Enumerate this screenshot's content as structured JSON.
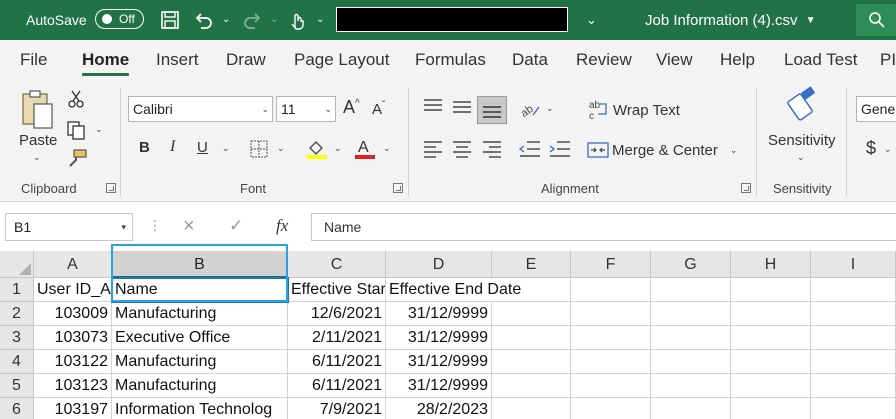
{
  "titlebar": {
    "autosave_label": "AutoSave",
    "autosave_state": "Off",
    "filename": "Job Information (4).csv"
  },
  "ribbon_tabs": [
    "File",
    "Home",
    "Insert",
    "Draw",
    "Page Layout",
    "Formulas",
    "Data",
    "Review",
    "View",
    "Help",
    "Load Test",
    "PI"
  ],
  "active_tab": "Home",
  "ribbon": {
    "clipboard": {
      "label": "Clipboard",
      "paste_label": "Paste"
    },
    "font": {
      "label": "Font",
      "font_name": "Calibri",
      "font_size": "11",
      "bold": "B",
      "italic": "I",
      "underline": "U",
      "grow": "A",
      "shrink": "A"
    },
    "alignment": {
      "label": "Alignment",
      "wrap_text": "Wrap Text",
      "merge_center": "Merge & Center"
    },
    "sensitivity": {
      "label": "Sensitivity",
      "button_label": "Sensitivity"
    },
    "number": {
      "format": "Gene",
      "currency": "$"
    }
  },
  "formula_bar": {
    "name_box": "B1",
    "cancel": "×",
    "enter": "✓",
    "fx": "fx",
    "formula": "Name"
  },
  "sheet": {
    "columns": [
      "A",
      "B",
      "C",
      "D",
      "E",
      "F",
      "G",
      "H",
      "I"
    ],
    "selected_column": "B",
    "rows": [
      {
        "num": "1",
        "a": "User ID_A",
        "b": "Name",
        "c": "Effective Star",
        "d": "Effective End Date"
      },
      {
        "num": "2",
        "a": "103009",
        "b": "Manufacturing",
        "c": "12/6/2021",
        "d": "31/12/9999"
      },
      {
        "num": "3",
        "a": "103073",
        "b": "Executive Office",
        "c": "2/11/2021",
        "d": "31/12/9999"
      },
      {
        "num": "4",
        "a": "103122",
        "b": "Manufacturing",
        "c": "6/11/2021",
        "d": "31/12/9999"
      },
      {
        "num": "5",
        "a": "103123",
        "b": "Manufacturing",
        "c": "6/11/2021",
        "d": "31/12/9999"
      },
      {
        "num": "6",
        "a": "103197",
        "b": "Information Technolog",
        "c": "7/9/2021",
        "d": "28/2/2023"
      }
    ]
  },
  "colors": {
    "excel_green": "#217346",
    "selection_blue": "#29a3df"
  }
}
